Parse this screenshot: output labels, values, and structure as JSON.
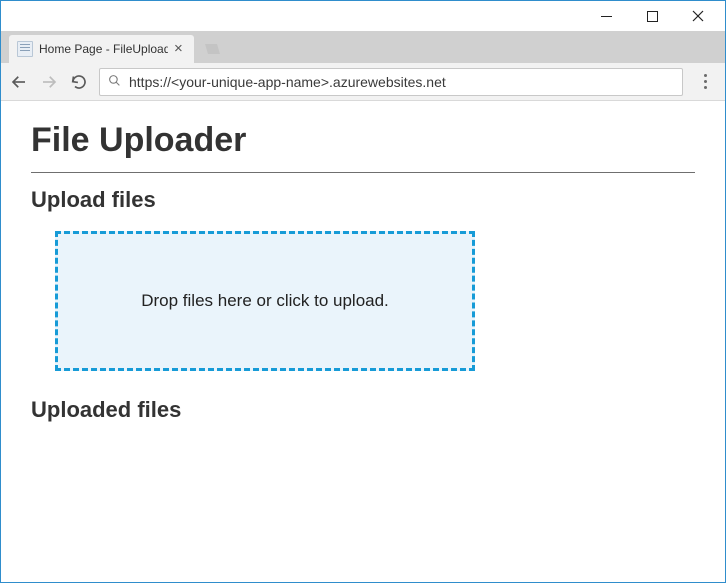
{
  "window": {
    "tab_title": "Home Page - FileUploade",
    "url": "https://<your-unique-app-name>.azurewebsites.net"
  },
  "page": {
    "title": "File Uploader",
    "upload_heading": "Upload files",
    "dropzone_text": "Drop files here or click to upload.",
    "uploaded_heading": "Uploaded files"
  }
}
